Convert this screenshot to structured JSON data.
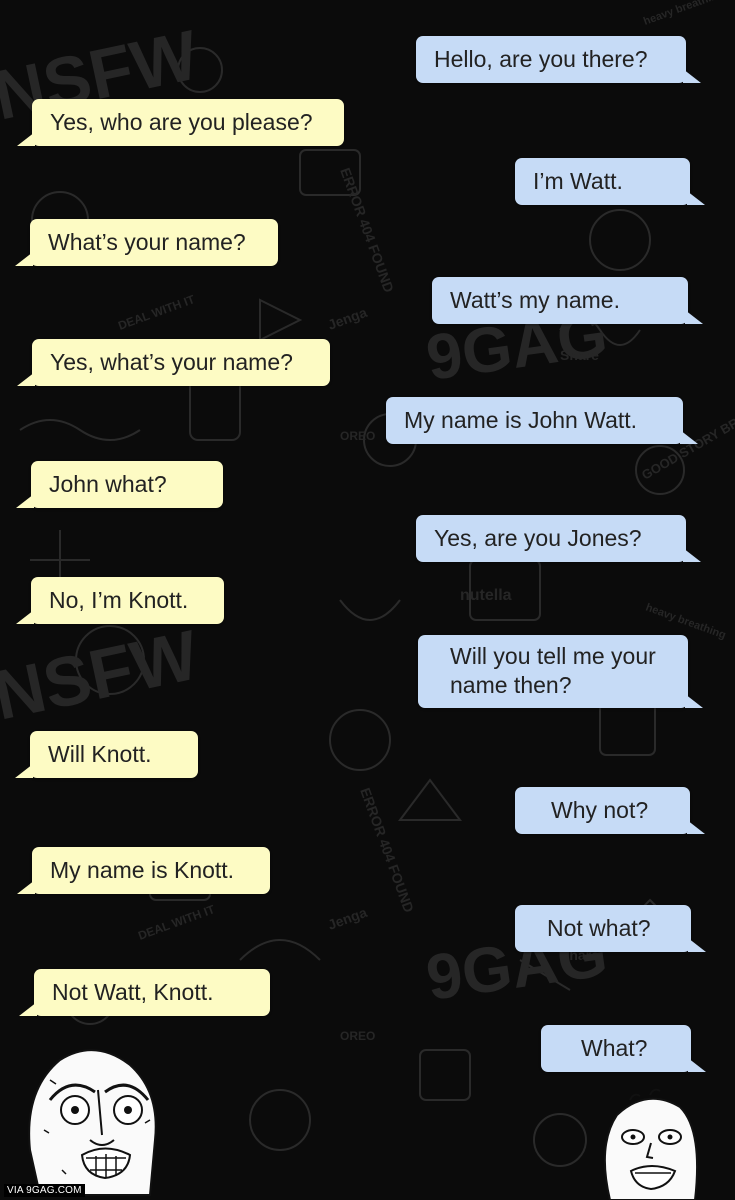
{
  "conversation": {
    "messages": [
      {
        "side": "right",
        "text": "Hello, are you there?"
      },
      {
        "side": "left",
        "text": "Yes, who are you please?"
      },
      {
        "side": "right",
        "text": "I’m Watt."
      },
      {
        "side": "left",
        "text": "What’s your name?"
      },
      {
        "side": "right",
        "text": "Watt’s my name."
      },
      {
        "side": "left",
        "text": "Yes, what’s your name?"
      },
      {
        "side": "right",
        "text": "My name is John Watt."
      },
      {
        "side": "left",
        "text": "John what?"
      },
      {
        "side": "right",
        "text": "Yes, are you Jones?"
      },
      {
        "side": "left",
        "text": "No, I’m Knott."
      },
      {
        "side": "right",
        "text": "Will you tell me your\nname then?"
      },
      {
        "side": "left",
        "text": "Will Knott."
      },
      {
        "side": "right",
        "text": "Why not?"
      },
      {
        "side": "left",
        "text": "My name is Knott."
      },
      {
        "side": "right",
        "text": "Not what?"
      },
      {
        "side": "left",
        "text": "Not Watt, Knott."
      },
      {
        "side": "right",
        "text": "What?"
      }
    ]
  },
  "background": {
    "doodle_words": [
      "NSFW",
      "9GAG",
      "ERROR 404 FOUND",
      "nutella",
      "Share",
      "OREO",
      "DEAL WITH IT",
      "GOOD STORY BRO",
      "Jenga",
      "heavy breathing"
    ]
  },
  "colors": {
    "background": "#0b0b0b",
    "left_bubble": "#fdfbc4",
    "right_bubble": "#c6dbf6",
    "text": "#222222"
  },
  "watermark": "VIA 9GAG.COM",
  "faces": {
    "left": "y-u-no-face",
    "right": "dumb-face"
  }
}
